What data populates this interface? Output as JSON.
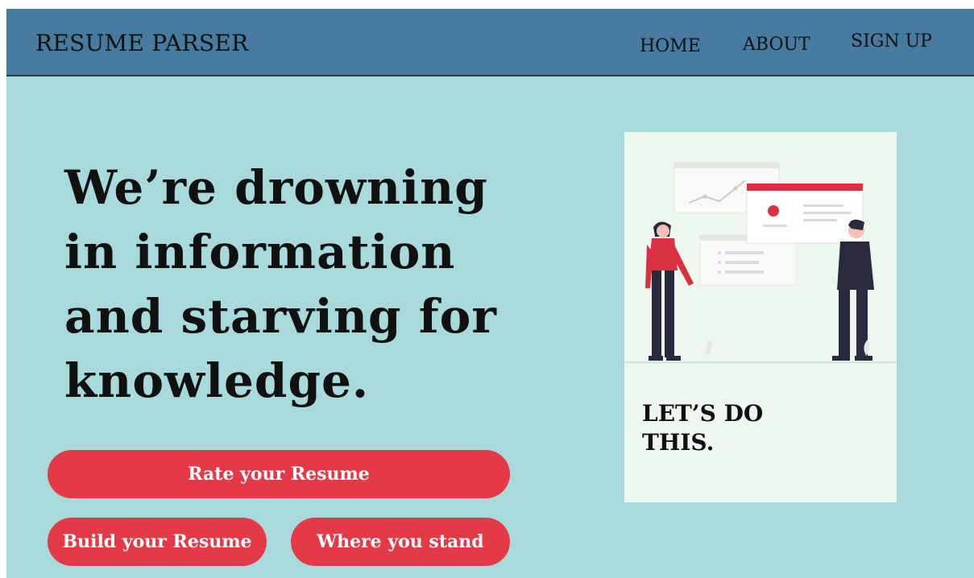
{
  "navbar": {
    "brand": "RESUME PARSER",
    "links": [
      {
        "label": "HOME"
      },
      {
        "label": "ABOUT"
      },
      {
        "label": "SIGN UP"
      }
    ]
  },
  "hero": {
    "headline_lines": [
      "We’re drowning",
      "in information",
      "and starving for",
      "knowledge."
    ]
  },
  "actions": {
    "rate_label": "Rate your Resume",
    "build_label": "Build your Resume",
    "stand_label": "Where you stand"
  },
  "card": {
    "cta_lines": [
      "LET’S DO",
      "THIS."
    ],
    "illustration": "two-people-presenting-dashboards"
  },
  "colors": {
    "navbar": "#467a9f",
    "background": "#a8d9db",
    "accent": "#e43a47",
    "card": "#eef7ef"
  }
}
